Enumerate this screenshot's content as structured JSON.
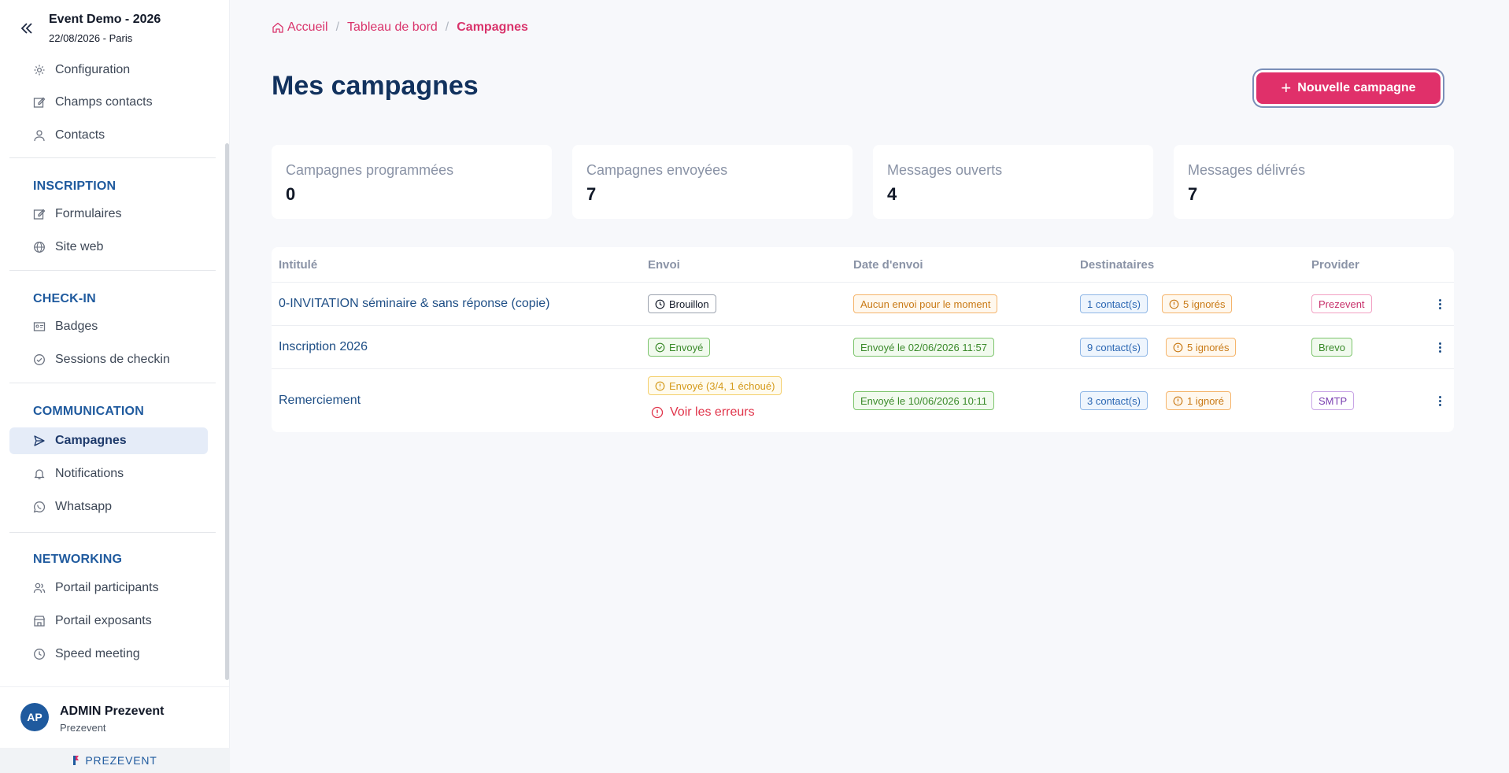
{
  "event": {
    "title": "Event Demo - 2026",
    "subtitle": "22/08/2026 - Paris"
  },
  "sidebar": {
    "top_items": [
      {
        "label": "Configuration",
        "icon": "gear-icon"
      },
      {
        "label": "Champs contacts",
        "icon": "edit-icon"
      },
      {
        "label": "Contacts",
        "icon": "user-icon"
      }
    ],
    "sections": [
      {
        "title": "INSCRIPTION",
        "items": [
          {
            "label": "Formulaires",
            "icon": "edit-icon"
          },
          {
            "label": "Site web",
            "icon": "globe-icon"
          }
        ]
      },
      {
        "title": "CHECK-IN",
        "items": [
          {
            "label": "Badges",
            "icon": "badge-icon"
          },
          {
            "label": "Sessions de checkin",
            "icon": "check-circle-icon"
          }
        ]
      },
      {
        "title": "COMMUNICATION",
        "items": [
          {
            "label": "Campagnes",
            "icon": "send-icon",
            "active": true
          },
          {
            "label": "Notifications",
            "icon": "bell-icon"
          },
          {
            "label": "Whatsapp",
            "icon": "whatsapp-icon"
          }
        ]
      },
      {
        "title": "NETWORKING",
        "items": [
          {
            "label": "Portail participants",
            "icon": "users-icon"
          },
          {
            "label": "Portail exposants",
            "icon": "store-icon"
          },
          {
            "label": "Speed meeting",
            "icon": "clock-icon"
          }
        ]
      }
    ]
  },
  "user": {
    "initials": "AP",
    "name": "ADMIN Prezevent",
    "org": "Prezevent"
  },
  "brand": {
    "name": "PREZEVENT"
  },
  "breadcrumb": {
    "home": "Accueil",
    "dashboard": "Tableau de bord",
    "current": "Campagnes"
  },
  "page": {
    "title": "Mes campagnes",
    "new_button": "Nouvelle campagne"
  },
  "stats": [
    {
      "label": "Campagnes programmées",
      "value": "0"
    },
    {
      "label": "Campagnes envoyées",
      "value": "7"
    },
    {
      "label": "Messages ouverts",
      "value": "4"
    },
    {
      "label": "Messages délivrés",
      "value": "7"
    }
  ],
  "table": {
    "headers": {
      "title": "Intitulé",
      "send": "Envoi",
      "date": "Date d'envoi",
      "recipients": "Destinataires",
      "provider": "Provider"
    },
    "rows": [
      {
        "title": "0-INVITATION séminaire & sans réponse (copie)",
        "status": "Brouillon",
        "date": "Aucun envoi pour le moment",
        "contacts": "1 contact(s)",
        "ignored": "5 ignorés",
        "provider": "Prezevent"
      },
      {
        "title": "Inscription 2026",
        "status": "Envoyé",
        "date": "Envoyé le 02/06/2026 11:57",
        "contacts": "9 contact(s)",
        "ignored": "5 ignorés",
        "provider": "Brevo"
      },
      {
        "title": "Remerciement",
        "status": "Envoyé (3/4, 1 échoué)",
        "errors": "Voir les erreurs",
        "date": "Envoyé le 10/06/2026 10:11",
        "contacts": "3 contact(s)",
        "ignored": "1 ignoré",
        "provider": "SMTP"
      }
    ]
  },
  "colors": {
    "accent": "#e0306a",
    "primary": "#12325e",
    "link": "#1f4f86"
  }
}
